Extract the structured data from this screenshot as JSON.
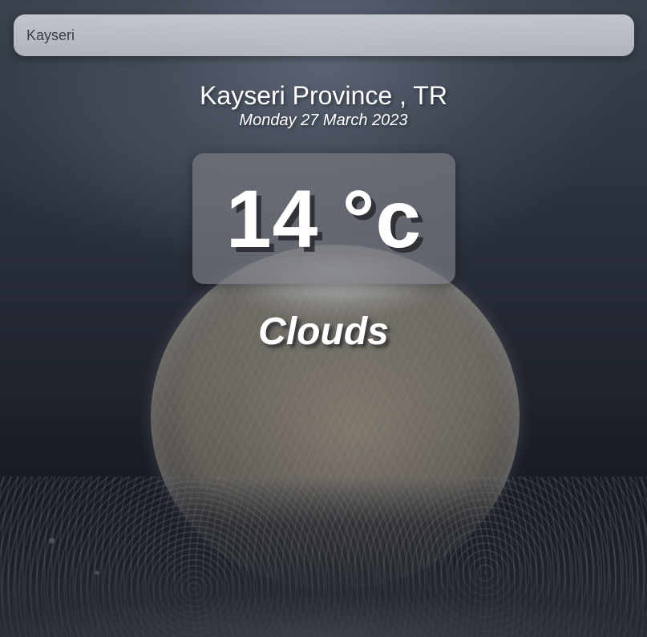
{
  "search": {
    "value": "Kayseri",
    "placeholder": ""
  },
  "location": {
    "title": "Kayseri Province , TR",
    "date": "Monday 27 March 2023"
  },
  "weather": {
    "temperature": "14 °c",
    "condition": "Clouds"
  }
}
